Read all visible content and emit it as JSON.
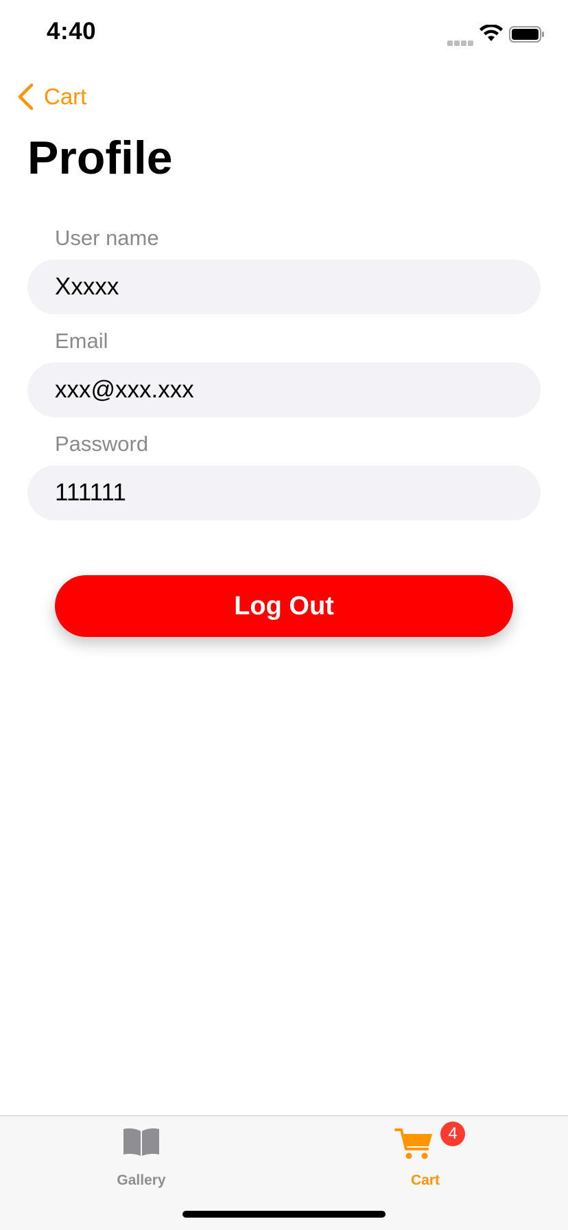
{
  "status_bar": {
    "time": "4:40"
  },
  "nav": {
    "back_label": "Cart",
    "title": "Profile"
  },
  "form": {
    "username": {
      "label": "User name",
      "value": "Xxxxx"
    },
    "email": {
      "label": "Email",
      "value": "xxx@xxx.xxx"
    },
    "password": {
      "label": "Password",
      "value": "111111"
    }
  },
  "actions": {
    "logout_label": "Log Out"
  },
  "tab_bar": {
    "tabs": [
      {
        "label": "Gallery",
        "icon": "book-icon",
        "selected": false
      },
      {
        "label": "Cart",
        "icon": "cart-icon",
        "selected": true,
        "badge": "4"
      }
    ]
  },
  "colors": {
    "accent": "#ff9500",
    "logout": "#ff0000",
    "badge": "#ff3b30",
    "field_bg": "#f2f2f7"
  }
}
